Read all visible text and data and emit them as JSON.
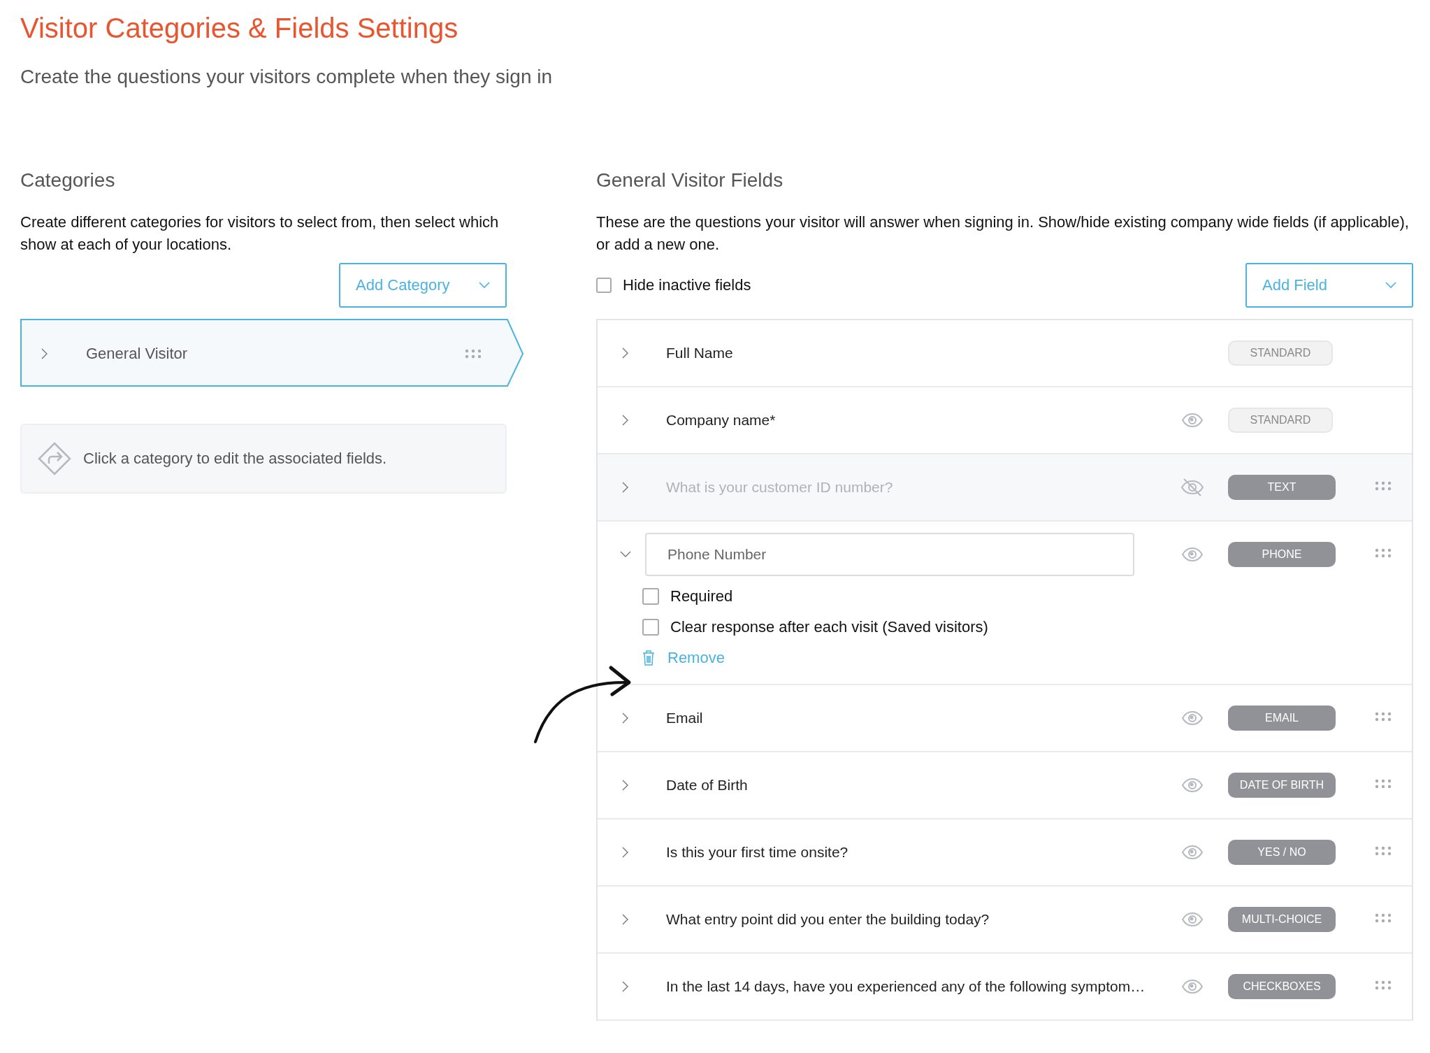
{
  "header": {
    "title": "Visitor Categories & Fields Settings",
    "subtitle": "Create the questions your visitors complete when they sign in"
  },
  "categories": {
    "heading": "Categories",
    "description": "Create different categories for visitors to select from, then select which show at each of your locations.",
    "add_button": "Add Category",
    "items": [
      {
        "name": "General Visitor",
        "selected": true
      }
    ],
    "hint": "Click a category to edit the associated fields."
  },
  "fields": {
    "heading": "General Visitor Fields",
    "description": "These are the questions your visitor will answer when signing in. Show/hide existing company wide fields (if applicable), or add a new one.",
    "hide_inactive": {
      "label": "Hide inactive fields",
      "checked": false
    },
    "add_button": "Add Field",
    "rows": [
      {
        "label": "Full Name",
        "kind": "fixed",
        "type": "STANDARD",
        "expanded": false
      },
      {
        "label": "Company name*",
        "kind": "standard",
        "type": "STANDARD",
        "visible": true,
        "expanded": false
      },
      {
        "label": "What is your customer ID number?",
        "kind": "custom",
        "type": "TEXT",
        "visible": false,
        "expanded": false
      },
      {
        "label": "Phone Number",
        "kind": "custom",
        "type": "PHONE",
        "visible": true,
        "expanded": true,
        "options": [
          {
            "label": "Required",
            "checked": false
          },
          {
            "label": "Clear response after each visit (Saved visitors)",
            "checked": false
          }
        ],
        "remove": "Remove"
      },
      {
        "label": "Email",
        "kind": "custom",
        "type": "EMAIL",
        "visible": true,
        "expanded": false
      },
      {
        "label": "Date of Birth",
        "kind": "custom",
        "type": "DATE OF BIRTH",
        "visible": true,
        "expanded": false
      },
      {
        "label": "Is this your first time onsite?",
        "kind": "custom",
        "type": "YES / NO",
        "visible": true,
        "expanded": false
      },
      {
        "label": "What entry point did you enter the building today?",
        "kind": "custom",
        "type": "MULTI-CHOICE",
        "visible": true,
        "expanded": false
      },
      {
        "label": "In the last 14 days, have you experienced any of the following symptom…",
        "kind": "custom",
        "type": "CHECKBOXES",
        "visible": true,
        "expanded": false
      }
    ]
  }
}
